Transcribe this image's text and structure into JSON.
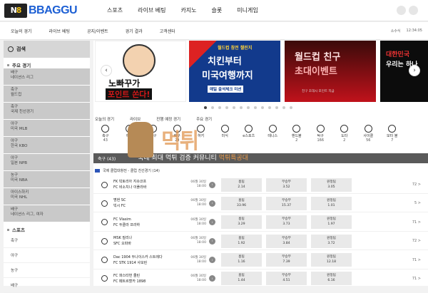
{
  "logo": {
    "mark_n": "N",
    "mark_accent": "8",
    "text": "BBAGGU"
  },
  "main_nav": [
    "스포츠",
    "라이브 베팅",
    "카지노",
    "슬롯",
    "미니게임"
  ],
  "sub_nav": [
    "오늘의 경기",
    "라이브 베팅",
    "공지/이벤트",
    "경기 결과",
    "고객센터"
  ],
  "sub_right": {
    "sort": "소수식",
    "time": "12:34:05"
  },
  "sidebar": {
    "search_label": "검색",
    "main_section": "주요 경기",
    "main_items": [
      {
        "line1": "배구",
        "line2": "네이션스 리그"
      },
      {
        "line1": "축구",
        "line2": "월드컵"
      },
      {
        "line1": "축구",
        "line2": "국제 친선경기"
      },
      {
        "line1": "야구",
        "line2": "미국 MLB"
      },
      {
        "line1": "야구",
        "line2": "한국 KBO"
      },
      {
        "line1": "야구",
        "line2": "일본 NPB"
      },
      {
        "line1": "농구",
        "line2": "미국 NBA"
      },
      {
        "line1": "아이스하키",
        "line2": "미국 NHL"
      },
      {
        "line1": "배구",
        "line2": "네이션스 리그, 여자"
      }
    ],
    "sports_section": "스포츠",
    "sports_items": [
      "축구",
      "야구",
      "농구",
      "배구"
    ]
  },
  "banners": [
    {
      "line1": "노빠꾸가",
      "line2": "포인트 쏜다!"
    },
    {
      "line0": "월드컵 참전 챌린지",
      "line1": "치킨부터",
      "line2": "미국여행까지",
      "line3": "매일 출석체크 미션"
    },
    {
      "line1": "월드컵 친구",
      "line2": "초대이벤트",
      "line3": "친구 초대시 포인트 지급"
    },
    {
      "line1": "대한민국",
      "line2": "우리는 하나"
    }
  ],
  "tabs": [
    "오늘의 경기",
    "라이브",
    "진행 예정 경기",
    "주요 경기"
  ],
  "sports": [
    {
      "name": "축구",
      "count": "43"
    },
    {
      "name": "야구",
      "count": ""
    },
    {
      "name": "농구",
      "count": ""
    },
    {
      "name": "배구",
      "count": "29"
    },
    {
      "name": "하키",
      "count": ""
    },
    {
      "name": "미식",
      "count": ""
    },
    {
      "name": "e스포츠",
      "count": ""
    },
    {
      "name": "테니스",
      "count": ""
    },
    {
      "name": "핸드볼",
      "count": "2"
    },
    {
      "name": "탁구",
      "count": "166"
    },
    {
      "name": "도타",
      "count": "2"
    },
    {
      "name": "사이클",
      "count": "56"
    },
    {
      "name": "모터 볼",
      "count": "7"
    }
  ],
  "sport_bar": "축구 (43)",
  "slogan": {
    "plain": "국내 최대 먹튀 검증 커뮤니티",
    "accent": "먹튀특공대"
  },
  "league": "국제 클럽대항전 - 클럽 친선경기 (14)",
  "matches": [
    {
      "home": "FK 빅토리아 지슈코프",
      "away": "FC 비소치나 이플라바",
      "date": "06월 30일",
      "time": "18:00",
      "o1": "2.14",
      "ox": "3.52",
      "o2": "3.05",
      "more": "72 >"
    },
    {
      "home": "명현 SC",
      "away": "빅시 FC",
      "date": "06월 30일",
      "time": "18:00",
      "o1": "33.96",
      "ox": "15.37",
      "o2": "1.01",
      "more": "5 >"
    },
    {
      "home": "FC Vlasim",
      "away": "FC 두클라 프라하",
      "date": "06월 30일",
      "time": "18:00",
      "o1": "3.29",
      "ox": "3.73",
      "o2": "1.97",
      "more": "71 >"
    },
    {
      "home": "MSK 질리나",
      "away": "SFC 오파바",
      "date": "06월 30일",
      "time": "18:00",
      "o1": "1.92",
      "ox": "3.84",
      "o2": "3.72",
      "more": "72 >"
    },
    {
      "home": "Dac 1904 두나이스카 스트레다",
      "away": "FC STK 1914 사모린",
      "date": "06월 30일",
      "time": "18:00",
      "o1": "1.16",
      "ox": "7.39",
      "o2": "12.18",
      "more": "71 >"
    },
    {
      "home": "FC 파스타번 줄린",
      "away": "FC 페트르할카 1898",
      "date": "06월 30일",
      "time": "18:00",
      "o1": "1.44",
      "ox": "4.51",
      "o2": "6.16",
      "more": "71 >"
    }
  ],
  "odds_labels": {
    "home": "홈팀",
    "draw": "무승부",
    "away": "원정팀"
  },
  "colors": {
    "brand": "#1c5fd4",
    "accent": "#e89a4b"
  }
}
